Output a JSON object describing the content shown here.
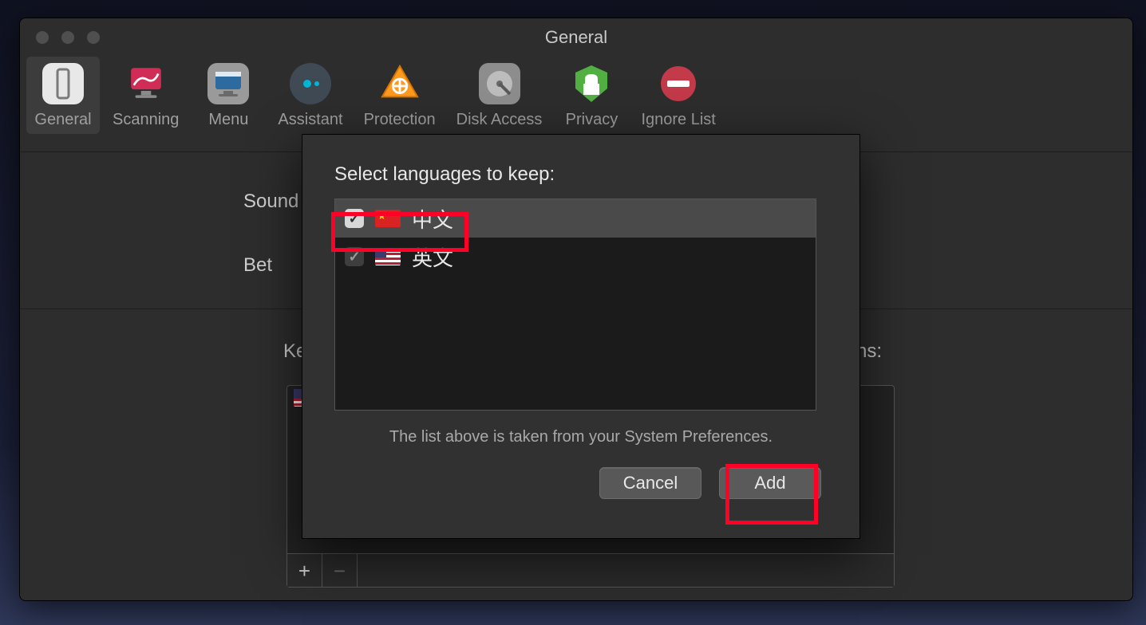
{
  "window": {
    "title": "General"
  },
  "toolbar": {
    "items": [
      {
        "id": "general",
        "label": "General",
        "selected": true
      },
      {
        "id": "scanning",
        "label": "Scanning",
        "selected": false
      },
      {
        "id": "menu",
        "label": "Menu",
        "selected": false
      },
      {
        "id": "assistant",
        "label": "Assistant",
        "selected": false
      },
      {
        "id": "protection",
        "label": "Protection",
        "selected": false
      },
      {
        "id": "disk-access",
        "label": "Disk Access",
        "selected": false
      },
      {
        "id": "privacy",
        "label": "Privacy",
        "selected": false
      },
      {
        "id": "ignore-list",
        "label": "Ignore List",
        "selected": false
      }
    ]
  },
  "content": {
    "side_labels": {
      "sound": "Sound",
      "beta": "Bet"
    },
    "keep_left": "Ke",
    "keep_right": "ns:",
    "list_footer": {
      "add": "+",
      "remove": "−"
    }
  },
  "dialog": {
    "title": "Select languages to keep:",
    "languages": [
      {
        "flag": "cn",
        "name": "中文",
        "checked": true,
        "selected": true
      },
      {
        "flag": "us",
        "name": "英文",
        "checked": true,
        "selected": false
      }
    ],
    "hint": "The list above is taken from your System Preferences.",
    "buttons": {
      "cancel": "Cancel",
      "add": "Add"
    }
  },
  "annotations": {
    "highlight_row": true,
    "highlight_add": true
  }
}
